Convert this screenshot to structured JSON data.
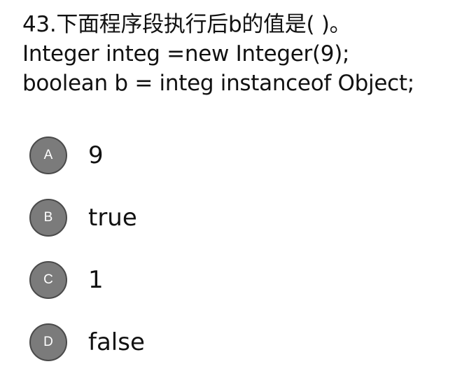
{
  "question": {
    "lines": [
      "43.下面程序段执行后b的值是(   )。",
      "Integer integ =new Integer(9);",
      "boolean b = integ instanceof Object;"
    ]
  },
  "options": [
    {
      "letter": "A",
      "text": "9"
    },
    {
      "letter": "B",
      "text": "true"
    },
    {
      "letter": "C",
      "text": "1"
    },
    {
      "letter": "D",
      "text": "false"
    }
  ],
  "colors": {
    "badge_fill": "#7b7b7b",
    "badge_border": "#4a4a4a",
    "text": "#111111"
  }
}
